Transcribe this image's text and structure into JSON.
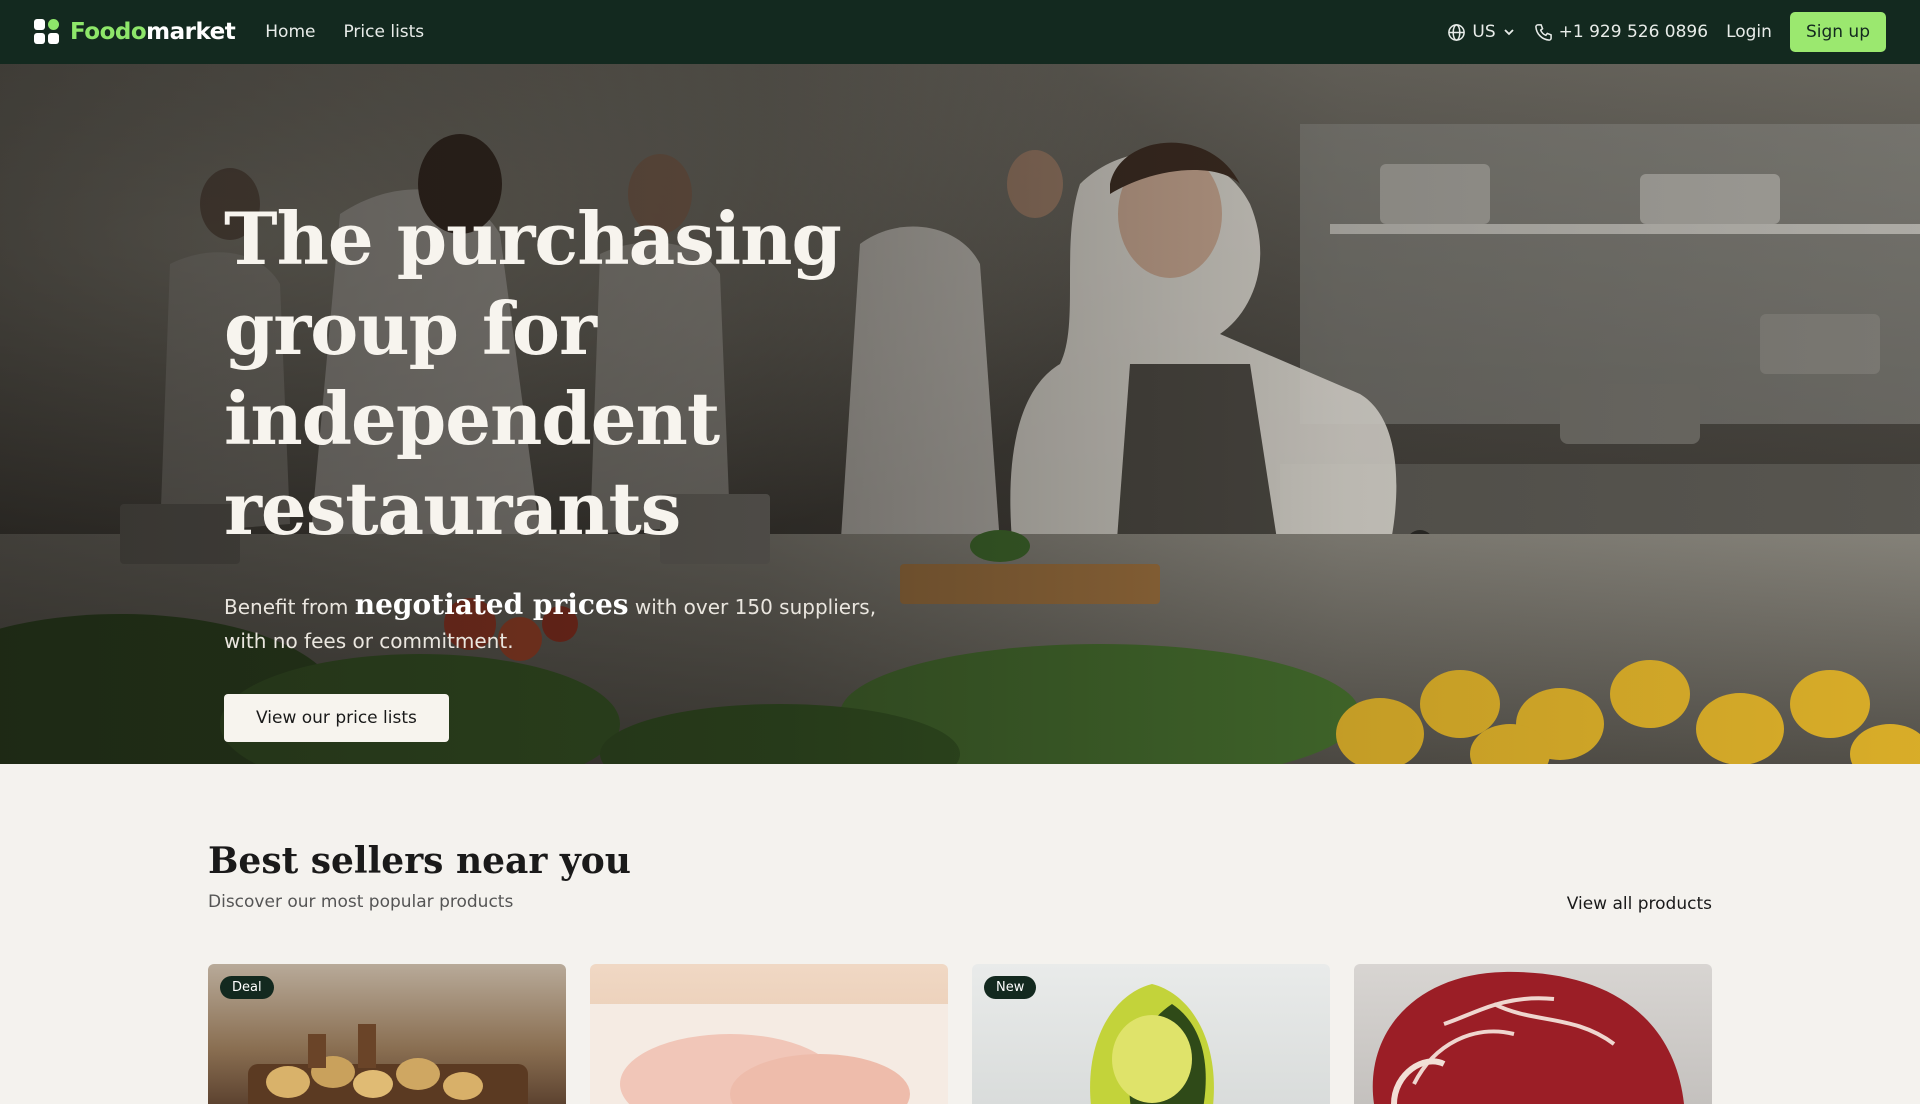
{
  "nav": {
    "logo_part1": "Foodo",
    "logo_part2": "market",
    "links": [
      "Home",
      "Price lists"
    ],
    "region": "US",
    "phone": "+1 929 526 0896",
    "login": "Login",
    "signup": "Sign up",
    "icons": [
      "globe-icon",
      "chevron-down-icon",
      "phone-icon"
    ]
  },
  "hero": {
    "title": "The purchasing group for independent restaurants",
    "sub_prefix": "Benefit from",
    "sub_emphasis": "negotiated prices",
    "sub_suffix": "with over 150 suppliers, with no fees or commitment.",
    "cta": "View our price lists"
  },
  "bestsellers": {
    "title": "Best sellers near you",
    "subtitle": "Discover our most popular products",
    "view_all": "View all products",
    "cards": [
      {
        "badge": "Deal",
        "image": "potatoes-image"
      },
      {
        "badge": "",
        "image": "chicken-image"
      },
      {
        "badge": "New",
        "image": "avocado-image"
      },
      {
        "badge": "",
        "image": "beef-image"
      }
    ]
  },
  "colors": {
    "nav_bg": "#13291f",
    "accent": "#9be86f",
    "page_bg": "#f4f2ee"
  }
}
